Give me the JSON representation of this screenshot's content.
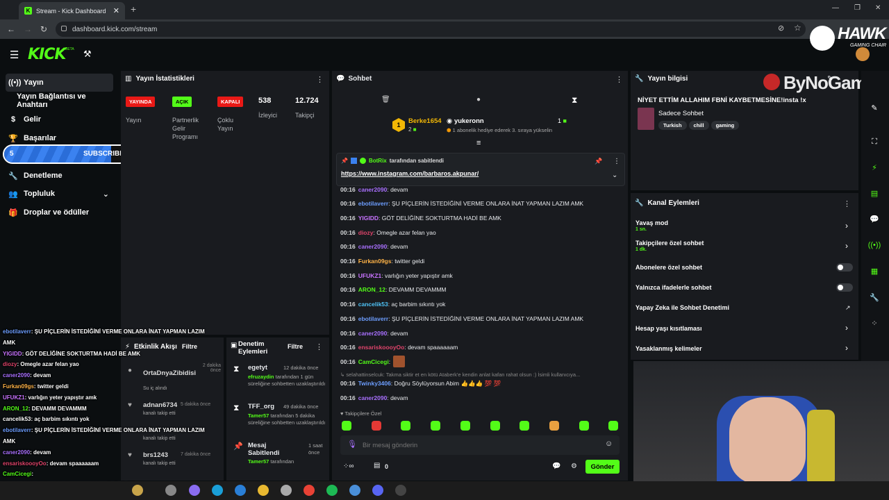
{
  "browser": {
    "tab_title": "Stream - Kick Dashboard",
    "new_tab": "+",
    "close": "✕",
    "url": "dashboard.kick.com/stream"
  },
  "header": {
    "logo": "KICK",
    "beta": "BETA"
  },
  "sidebar": {
    "items": [
      {
        "label": "Yayın",
        "icon": "broadcast-icon"
      },
      {
        "label": "Yayın Bağlantısı ve Anahtarı",
        "icon": ""
      },
      {
        "label": "Gelir",
        "icon": "dollar-icon"
      },
      {
        "label": "Başarılar",
        "icon": "trophy-icon"
      },
      {
        "label": "Denetleme",
        "icon": "wrench-icon"
      },
      {
        "label": "Topluluk",
        "icon": "people-icon"
      },
      {
        "label": "Droplar ve ödüller",
        "icon": "gift-icon"
      }
    ],
    "subscribers_bar": {
      "left": "5",
      "label": "SUBSCRIBERS",
      "right": "10",
      "progress": 0.5
    }
  },
  "stats": {
    "title": "Yayın İstatistikleri",
    "badges": [
      {
        "text": "YAYINDA",
        "color": "#e91916",
        "label": "Yayın"
      },
      {
        "text": "AÇIK",
        "color": "#53fc18",
        "label": "Partnerlik Gelir Programı"
      },
      {
        "text": "KAPALI",
        "color": "#e91916",
        "label": "Çoklu Yayın"
      }
    ],
    "viewers": "538",
    "viewers_label": "İzleyici",
    "followers": "12.724",
    "followers_label": "Takipçi"
  },
  "activity": {
    "title": "Etkinlik Akışı",
    "filter": "Filtre",
    "items": [
      {
        "user": "OrtaDnyaZibidisi",
        "time": "2 dakika önce",
        "desc": "Su iç alındı"
      },
      {
        "user": "adnan6734",
        "time": "5 dakika önce",
        "desc": "kanalı takip etti"
      },
      {
        "user": "",
        "time": "",
        "desc": "kanalı takip etti"
      },
      {
        "user": "brs1243",
        "time": "7 dakika önce",
        "desc": "kanalı takip etti"
      }
    ]
  },
  "modlog": {
    "title": "Denetim Eylemleri",
    "filter": "Filtre",
    "items": [
      {
        "title": "egetyt",
        "time": "12 dakika önce",
        "by": "efruzaydin",
        "desc": "tarafından 1 gün süreliğine sohbetten uzaklaştırıldı"
      },
      {
        "title": "TFF_org",
        "time": "49 dakika önce",
        "by": "Tamer57",
        "desc": "tarafından 5 dakika süreliğine sohbetten uzaklaştırıldı"
      },
      {
        "title": "Mesaj Sabitlendi",
        "time": "1 saat önce",
        "by": "Tamer57",
        "desc": "tarafından"
      }
    ]
  },
  "chat": {
    "title": "Sohbet",
    "top_gifter": "Berke1654",
    "top_gifter_count": "2",
    "gift_user": "yukeronn",
    "gift_count": "1",
    "gift_text": "1 abonelik hediye ederek 3. sıraya yükselin",
    "pinned_by": "BotRix",
    "pinned_by_text": "tarafından sabitlendi",
    "pinned_link": "https://www.instagram.com/barbaros.akpunar/",
    "messages": [
      {
        "t": "00:16",
        "u": "caner2090",
        "c": "#a970ff",
        "m": ": devam"
      },
      {
        "t": "00:16",
        "u": "ebotilaverr",
        "c": "#6d9eff",
        "m": ": ŞU PİÇLERİN İSTEDİĞİNİ VERME ONLARA İNAT YAPMAN LAZIM AMK"
      },
      {
        "t": "00:16",
        "u": "YIGIDD",
        "c": "#c873ff",
        "m": ": GÖT DELİĞİNE SOKTURTMA HADİ BE AMK"
      },
      {
        "t": "00:16",
        "u": "diozy",
        "c": "#e0446b",
        "m": ": Omegle azar felan yao"
      },
      {
        "t": "00:16",
        "u": "caner2090",
        "c": "#a970ff",
        "m": ": devam"
      },
      {
        "t": "00:16",
        "u": "Furkan09gs",
        "c": "#ffb347",
        "m": ": twitter geldi"
      },
      {
        "t": "00:16",
        "u": "UFUKZ1",
        "c": "#c873ff",
        "m": ": varlığın yeter yapıştır amk"
      },
      {
        "t": "00:16",
        "u": "ARON_12",
        "c": "#53fc18",
        "m": ": DEVAMM DEVAMMM"
      },
      {
        "t": "00:16",
        "u": "cancelik53",
        "c": "#4fc3f7",
        "m": ": aç barbim sıkıntı yok"
      },
      {
        "t": "00:16",
        "u": "ebotilaverr",
        "c": "#6d9eff",
        "m": ": ŞU PİÇLERİN İSTEDİĞİNİ VERME ONLARA İNAT YAPMAN LAZIM AMK"
      },
      {
        "t": "00:16",
        "u": "caner2090",
        "c": "#a970ff",
        "m": ": devam"
      },
      {
        "t": "00:16",
        "u": "ensariskoooyOo",
        "c": "#e0446b",
        "m": ": devam spaaaaaam"
      },
      {
        "t": "00:16",
        "u": "CamCicegi",
        "c": "#53fc18",
        "m": ":"
      }
    ],
    "reply_hint": "selahattinselcuk: Takma siktir et en kötü Ataberk'e kendin anlat kafan rahat olsun :) İsimli kullanıcıya...",
    "reply_msg": {
      "t": "00:16",
      "u": "Twinky3406",
      "c": "#6d9eff",
      "m": ": Doğru Söylüyorsun Abim 👍👍👍 💯 💯"
    },
    "last_msg": {
      "t": "00:16",
      "u": "caner2090",
      "c": "#a970ff",
      "m": ": devam"
    },
    "followers_only": "Takipçilere Özel",
    "input_placeholder": "Bir mesaj gönderin",
    "counter": "0",
    "send": "Gönder"
  },
  "stream_info": {
    "title": "Yayın bilgisi",
    "stream_title": "NİYET ETTİM ALLAHIM FBNİ KAYBETMESİNE!insta !x",
    "category": "Sadece Sohbet",
    "tags": [
      "Turkish",
      "chill",
      "gaming"
    ]
  },
  "channel_actions": {
    "title": "Kanal Eylemleri",
    "items": [
      {
        "label": "Yavaş mod",
        "sub": "1 sn.",
        "type": "chevron"
      },
      {
        "label": "Takipçilere özel sohbet",
        "sub": "1 dk.",
        "type": "chevron"
      },
      {
        "label": "Abonelere özel sohbet",
        "sub": "",
        "type": "toggle"
      },
      {
        "label": "Yalnızca ifadelerle sohbet",
        "sub": "",
        "type": "toggle"
      },
      {
        "label": "Yapay Zeka ile Sohbet Denetimi",
        "sub": "",
        "type": "external"
      },
      {
        "label": "Hesap yaşı kısıtlaması",
        "sub": "",
        "type": "chevron"
      },
      {
        "label": "Yasaklanmış kelimeler",
        "sub": "",
        "type": "chevron"
      }
    ]
  },
  "overlay": {
    "brand": "HAWK",
    "brand_sub": "GAMING CHAIR",
    "watermark": "ByNoGame",
    "chat": [
      {
        "u": "ebotilaverr",
        "c": "#6d9eff",
        "m": ": ŞU PİÇLERİN İSTEDİĞİNİ VERME ONLARA İNAT YAPMAN LAZIM"
      },
      {
        "u": "",
        "c": "#fff",
        "m": "AMK"
      },
      {
        "u": "YIGIDD",
        "c": "#c873ff",
        "m": ": GÖT DELİĞİNE SOKTURTMA HADİ BE AMK"
      },
      {
        "u": "diozy",
        "c": "#e0446b",
        "m": ": Omegle azar felan yao"
      },
      {
        "u": "caner2090",
        "c": "#a970ff",
        "m": ": devam"
      },
      {
        "u": "Furkan09gs",
        "c": "#ffb347",
        "m": ": twitter geldi"
      },
      {
        "u": "UFUKZ1",
        "c": "#c873ff",
        "m": ": varlığın yeter yapıştır amk"
      },
      {
        "u": "ARON_12",
        "c": "#53fc18",
        "m": ": DEVAMM DEVAMMM"
      },
      {
        "u": "cancelik53",
        "c": "#fff",
        "m": ": aç barbim sıkıntı yok"
      },
      {
        "u": "ebotilaverr",
        "c": "#6d9eff",
        "m": ": ŞU PİÇLERİN İSTEDİĞİNİ VERME ONLARA İNAT YAPMAN LAZIM"
      },
      {
        "u": "",
        "c": "#fff",
        "m": "AMK"
      },
      {
        "u": "caner2090",
        "c": "#a970ff",
        "m": ": devam"
      },
      {
        "u": "ensariskoooyOo",
        "c": "#e0446b",
        "m": ": devam spaaaaaam"
      },
      {
        "u": "CamCicegi",
        "c": "#53fc18",
        "m": ":"
      },
      {
        "u": "Twinky3406",
        "c": "#6d9eff",
        "m": ": Doğru Söylüyorsun Abim 👍👍👍 💯"
      },
      {
        "u": "caner2090",
        "c": "#a970ff",
        "m": ": devam"
      }
    ]
  }
}
